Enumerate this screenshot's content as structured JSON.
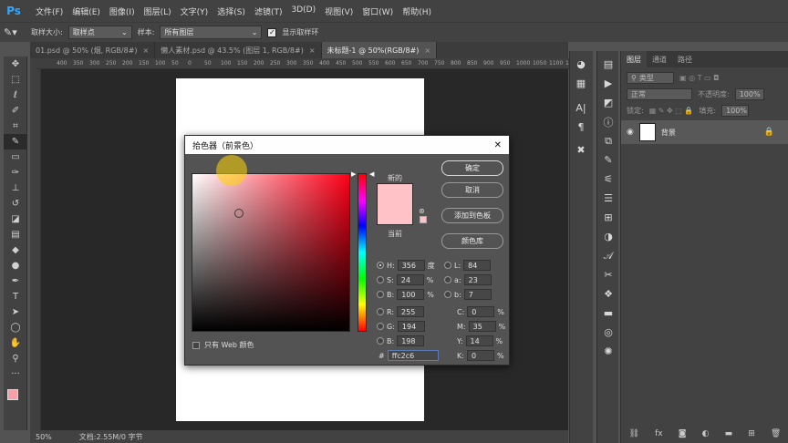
{
  "app": {
    "logo": "Ps"
  },
  "menu": [
    "文件(F)",
    "编辑(E)",
    "图像(I)",
    "图层(L)",
    "文字(Y)",
    "选择(S)",
    "滤镜(T)",
    "3D(D)",
    "视图(V)",
    "窗口(W)",
    "帮助(H)"
  ],
  "options": {
    "sample_size_label": "取样大小:",
    "sample_size_value": "取样点",
    "sample_label": "样本:",
    "sample_value": "所有图层",
    "show_ring_label": "显示取样环",
    "show_ring_checked": "✓"
  },
  "tabs": [
    {
      "label": "01.psd @ 50% (烟, RGB/8#)",
      "close": "×"
    },
    {
      "label": "懒人素材.psd @ 43.5% (图层 1, RGB/8#)",
      "close": "×"
    },
    {
      "label": "未标题-1 @ 50%(RGB/8#)",
      "close": "×"
    }
  ],
  "ruler": {
    "ticks": [
      "400",
      "350",
      "300",
      "250",
      "200",
      "150",
      "100",
      "50",
      "0",
      "50",
      "100",
      "150",
      "200",
      "250",
      "300",
      "350",
      "400",
      "450",
      "500",
      "550",
      "600",
      "650",
      "700",
      "750",
      "800",
      "850",
      "900",
      "950",
      "1000",
      "1050",
      "1100",
      "1150"
    ]
  },
  "status": {
    "zoom": "50%",
    "doc_info": "文档:2.55M/0 字节"
  },
  "layers": {
    "tabs": [
      "图层",
      "通道",
      "路径"
    ],
    "filter_placeholder": "类型",
    "blend_mode": "正常",
    "opacity_label": "不透明度:",
    "opacity_value": "100%",
    "lock_label": "锁定:",
    "fill_label": "填充:",
    "fill_value": "100%",
    "layer_name": "背景"
  },
  "dialog": {
    "title": "拾色器（前景色）",
    "close": "✕",
    "new_label": "新的",
    "current_label": "当前",
    "buttons": {
      "ok": "确定",
      "cancel": "取消",
      "add_swatch": "添加到色板",
      "libraries": "颜色库"
    },
    "hsb": {
      "h_label": "H:",
      "h": "356",
      "h_unit": "度",
      "s_label": "S:",
      "s": "24",
      "s_unit": "%",
      "b_label": "B:",
      "b": "100",
      "b_unit": "%"
    },
    "lab": {
      "l_label": "L:",
      "l": "84",
      "a_label": "a:",
      "a": "23",
      "b_label": "b:",
      "b": "7"
    },
    "rgb": {
      "r_label": "R:",
      "r": "255",
      "g_label": "G:",
      "g": "194",
      "b_label": "B:",
      "b": "198"
    },
    "cmyk": {
      "c_label": "C:",
      "c": "0",
      "m_label": "M:",
      "m": "35",
      "y_label": "Y:",
      "y": "14",
      "k_label": "K:",
      "k": "0",
      "unit": "%"
    },
    "hex_label": "#",
    "hex": "ffc2c6",
    "web_only_label": "只有 Web 颜色",
    "color": "#ffc2c6"
  },
  "icons": {
    "tools": [
      "move-icon",
      "marquee-icon",
      "lasso-icon",
      "quick-select-icon",
      "crop-icon",
      "eyedropper-icon",
      "healing-icon",
      "brush-icon",
      "stamp-icon",
      "history-brush-icon",
      "eraser-icon",
      "gradient-icon",
      "blur-icon",
      "dodge-icon",
      "pen-icon",
      "type-icon",
      "path-select-icon",
      "shape-icon",
      "hand-icon",
      "zoom-icon",
      "more-icon"
    ]
  }
}
